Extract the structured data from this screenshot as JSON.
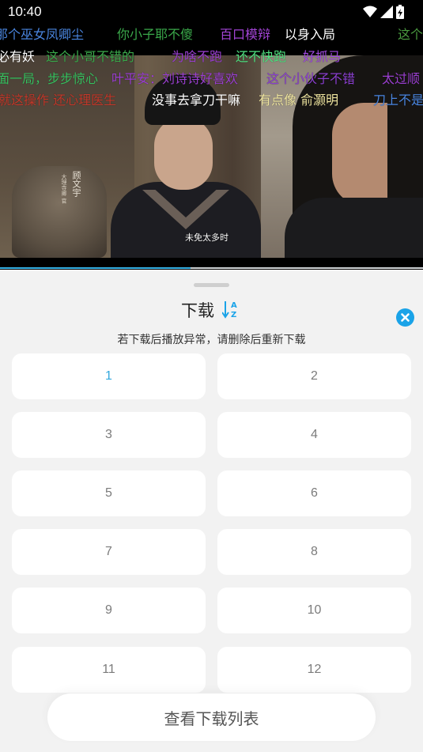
{
  "status_bar": {
    "time": "10:40"
  },
  "video": {
    "subtitle": "未免太多时",
    "name_tag": "顾文宇",
    "name_tag_small": "大理寺卿 官",
    "progress_fraction": 0.45
  },
  "danmaku": [
    {
      "text": "那个巫女凤卿尘",
      "color": "#4a86e0"
    },
    {
      "text": "你小子耶不傻",
      "color": "#3aa84a"
    },
    {
      "text": "百口模辩",
      "color": "#a344d6"
    },
    {
      "text": "以身入局",
      "color": "#ffffff"
    },
    {
      "text": "这个",
      "color": "#4a9a3f"
    },
    {
      "text": "必有妖",
      "color": "#ffffff"
    },
    {
      "text": "这个小哥不错的",
      "color": "#3aa84a"
    },
    {
      "text": "为啥不跑",
      "color": "#9a3fd0"
    },
    {
      "text": "还不快跑",
      "color": "#50e080"
    },
    {
      "text": "好抓马",
      "color": "#a049e0"
    },
    {
      "text": "面一局，步步惊心",
      "color": "#38c060"
    },
    {
      "text": "叶平安：刘诗诗好喜欢",
      "color": "#9a3fd0"
    },
    {
      "text": "这个小伙子不错",
      "color": "#8a3fcf"
    },
    {
      "text": "太过顺",
      "color": "#9a3fd0"
    },
    {
      "text": "就这操作 还心理医生",
      "color": "#c0392b"
    },
    {
      "text": "没事去拿刀干嘛",
      "color": "#ffffff"
    },
    {
      "text": "有点像 俞灏明",
      "color": "#f0e6a0"
    },
    {
      "text": "刀上不是",
      "color": "#4a86e0"
    }
  ],
  "sheet": {
    "title": "下载",
    "sort_icon": "sort-az-icon",
    "close_icon": "close-icon",
    "notice": "若下载后播放异常，请删除后重新下载",
    "episodes": [
      "1",
      "2",
      "3",
      "4",
      "5",
      "6",
      "7",
      "8",
      "9",
      "10",
      "11",
      "12"
    ],
    "selected_episode": "1",
    "view_list_label": "查看下载列表"
  },
  "colors": {
    "accent": "#1aa3e8",
    "selected_text": "#33a8dd",
    "sheet_bg": "#f2f2f2"
  }
}
